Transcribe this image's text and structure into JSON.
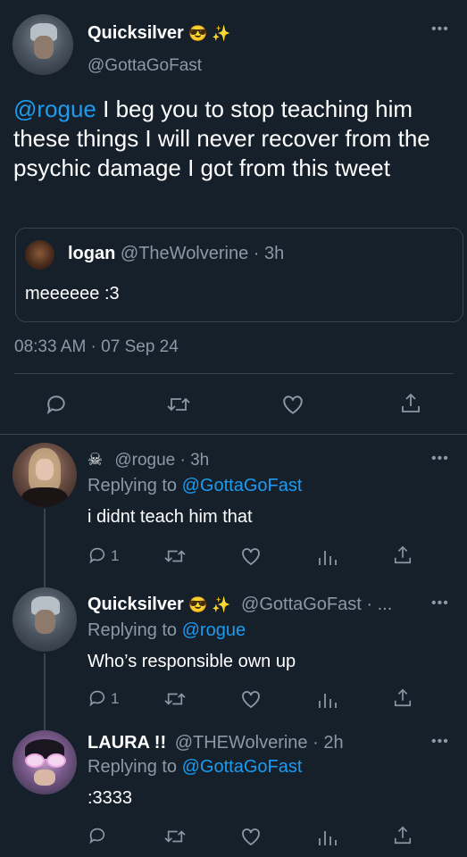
{
  "main_tweet": {
    "display_name": "Quicksilver",
    "emoji": "😎 ✨",
    "handle": "@GottaGoFast",
    "mention": "@rogue",
    "text": " I beg you to stop teaching him these things I will never recover from the psychic damage I got from this tweet",
    "quote": {
      "display_name": "logan",
      "meta": "@TheWolverine · 3h",
      "text": "meeeeee :3"
    },
    "timestamp": "08:33 AM · 07 Sep 24"
  },
  "replies": [
    {
      "name_prefix": "☠",
      "display_name": "",
      "meta": "@rogue · 3h",
      "replying_label": "Replying to",
      "replying_to": "@GottaGoFast",
      "text": "i didnt teach him that",
      "reply_count": "1"
    },
    {
      "display_name": "Quicksilver",
      "emoji": "😎 ✨",
      "meta": "@GottaGoFast · ...",
      "replying_label": "Replying to",
      "replying_to": "@rogue",
      "text": "Who’s responsible own up",
      "reply_count": "1"
    },
    {
      "display_name": "LAURA !!",
      "meta": "@THEWolverine · 2h",
      "replying_label": "Replying to",
      "replying_to": "@GottaGoFast",
      "text": ":3333",
      "reply_count": ""
    }
  ],
  "colors": {
    "background": "#15202b",
    "accent": "#1d9bf0",
    "muted": "#8b98a5",
    "border": "#38444d"
  }
}
